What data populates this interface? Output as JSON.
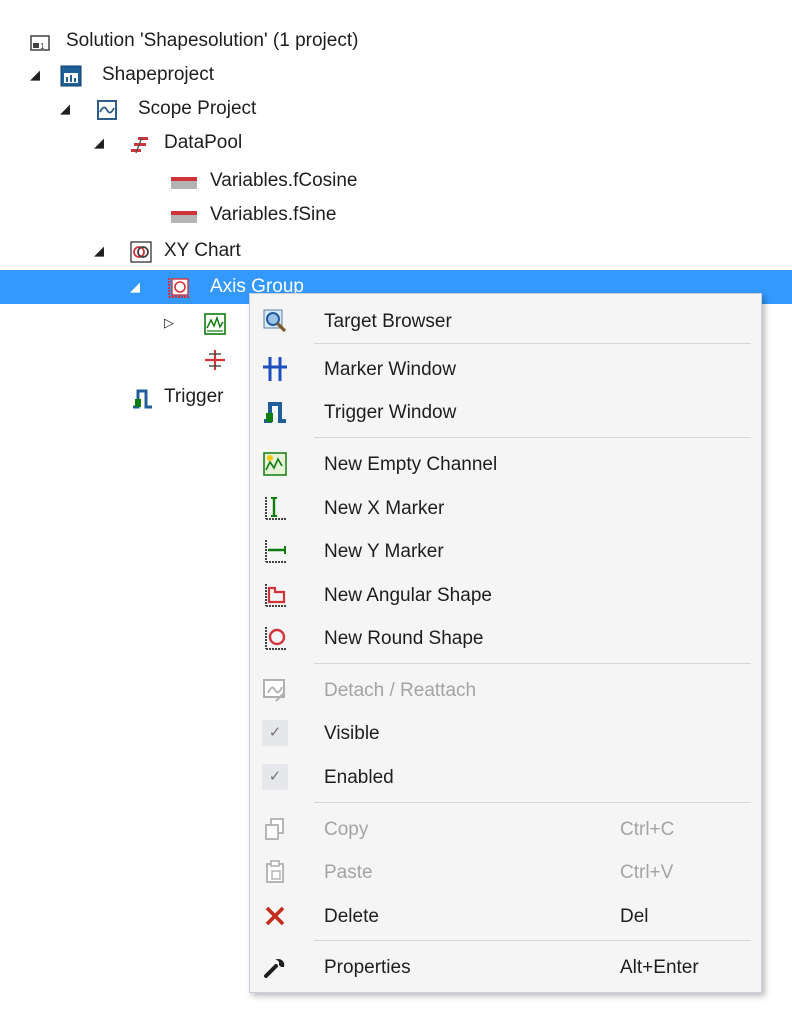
{
  "tree": {
    "solution": "Solution 'Shapesolution' (1 project)",
    "shapeproject": "Shapeproject",
    "scope_project": "Scope Project",
    "datapool": "DataPool",
    "var_cosine": "Variables.fCosine",
    "var_sine": "Variables.fSine",
    "xy_chart": "XY Chart",
    "axis_group": "Axis Group",
    "trigger": "Trigger"
  },
  "menu": {
    "target_browser": "Target Browser",
    "marker_window": "Marker Window",
    "trigger_window": "Trigger Window",
    "new_empty_channel": "New Empty Channel",
    "new_x_marker": "New X Marker",
    "new_y_marker": "New Y Marker",
    "new_angular_shape": "New Angular Shape",
    "new_round_shape": "New Round Shape",
    "detach_reattach": "Detach / Reattach",
    "visible": "Visible",
    "enabled": "Enabled",
    "copy": "Copy",
    "copy_shortcut": "Ctrl+C",
    "paste": "Paste",
    "paste_shortcut": "Ctrl+V",
    "delete": "Delete",
    "delete_shortcut": "Del",
    "properties": "Properties",
    "properties_shortcut": "Alt+Enter",
    "check_glyph": "✓"
  },
  "icons": {
    "solution": "solution-icon",
    "project": "project-icon",
    "scope": "scope-project-icon",
    "datapool": "datapool-icon",
    "variable": "variable-icon",
    "xychart": "xy-chart-icon",
    "axisgroup": "axis-group-icon",
    "channel": "channel-icon",
    "marker": "marker-icon",
    "trigger": "trigger-icon"
  },
  "colors": {
    "selection": "#3399ff",
    "menu_background": "#f5f5f5",
    "disabled_text": "#a2a4a5",
    "delete_red": "#c42b1c"
  }
}
